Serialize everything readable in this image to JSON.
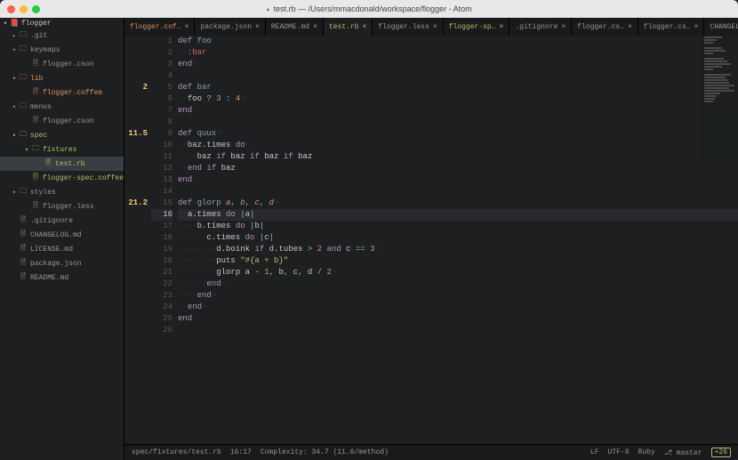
{
  "window": {
    "title": "test.rb — /Users/mmacdonald/workspace/flogger - Atom"
  },
  "sidebar": {
    "root": "flogger",
    "items": [
      {
        "pad": 12,
        "chev": "▸",
        "icon": "🗀",
        "label": ".git",
        "cls": ""
      },
      {
        "pad": 12,
        "chev": "▾",
        "icon": "🗀",
        "label": "keymaps",
        "cls": ""
      },
      {
        "pad": 26,
        "chev": "",
        "icon": "🗎",
        "label": "flogger.cson",
        "cls": ""
      },
      {
        "pad": 12,
        "chev": "▾",
        "icon": "🗀",
        "label": "lib",
        "cls": "modified"
      },
      {
        "pad": 26,
        "chev": "",
        "icon": "🗎",
        "label": "flogger.coffee",
        "cls": "modified"
      },
      {
        "pad": 12,
        "chev": "▾",
        "icon": "🗀",
        "label": "menus",
        "cls": ""
      },
      {
        "pad": 26,
        "chev": "",
        "icon": "🗎",
        "label": "flogger.cson",
        "cls": ""
      },
      {
        "pad": 12,
        "chev": "▾",
        "icon": "🗀",
        "label": "spec",
        "cls": "new"
      },
      {
        "pad": 26,
        "chev": "▾",
        "icon": "🗀",
        "label": "fixtures",
        "cls": "new"
      },
      {
        "pad": 40,
        "chev": "",
        "icon": "🗎",
        "label": "test.rb",
        "cls": "new active"
      },
      {
        "pad": 26,
        "chev": "",
        "icon": "🗎",
        "label": "flogger-spec.coffee",
        "cls": "new"
      },
      {
        "pad": 12,
        "chev": "▾",
        "icon": "🗀",
        "label": "styles",
        "cls": ""
      },
      {
        "pad": 26,
        "chev": "",
        "icon": "🗎",
        "label": "flogger.less",
        "cls": ""
      },
      {
        "pad": 12,
        "chev": "",
        "icon": "🗎",
        "label": ".gitignore",
        "cls": ""
      },
      {
        "pad": 12,
        "chev": "",
        "icon": "🗎",
        "label": "CHANGELOG.md",
        "cls": ""
      },
      {
        "pad": 12,
        "chev": "",
        "icon": "🗎",
        "label": "LICENSE.md",
        "cls": ""
      },
      {
        "pad": 12,
        "chev": "",
        "icon": "🗎",
        "label": "package.json",
        "cls": ""
      },
      {
        "pad": 12,
        "chev": "",
        "icon": "🗎",
        "label": "README.md",
        "cls": ""
      }
    ]
  },
  "tabs": [
    {
      "label": "flogger.cof…",
      "cls": "modified"
    },
    {
      "label": "package.json",
      "cls": ""
    },
    {
      "label": "README.md",
      "cls": ""
    },
    {
      "label": "test.rb",
      "cls": "new active"
    },
    {
      "label": "flogger.less",
      "cls": ""
    },
    {
      "label": "flogger-sp…",
      "cls": "new"
    },
    {
      "label": ".gitignore",
      "cls": ""
    },
    {
      "label": "flogger.cs…",
      "cls": ""
    },
    {
      "label": "flogger.cs…",
      "cls": ""
    },
    {
      "label": "CHANGEL…",
      "cls": ""
    }
  ],
  "complexity": {
    "5": "2",
    "9": "11.5",
    "15": "21.2"
  },
  "code_lines": [
    [
      [
        "kw",
        "def "
      ],
      [
        "def",
        "foo"
      ]
    ],
    [
      [
        "ws",
        "··"
      ],
      [
        "sym",
        ":bar"
      ]
    ],
    [
      [
        "kw",
        "end"
      ],
      [
        "ws",
        "¬"
      ]
    ],
    [],
    [
      [
        "kw",
        "def "
      ],
      [
        "def",
        "bar"
      ]
    ],
    [
      [
        "ws",
        "··"
      ],
      [
        "",
        "foo "
      ],
      [
        "op",
        "?"
      ],
      [
        "",
        " "
      ],
      [
        "num",
        "3"
      ],
      [
        "",
        " "
      ],
      [
        "op",
        ":"
      ],
      [
        "",
        " "
      ],
      [
        "num",
        "4"
      ],
      [
        "ws",
        "¬"
      ]
    ],
    [
      [
        "kw",
        "end"
      ]
    ],
    [],
    [
      [
        "kw",
        "def "
      ],
      [
        "def",
        "quux"
      ],
      [
        "ws",
        "¬"
      ]
    ],
    [
      [
        "ws",
        "··"
      ],
      [
        "",
        "baz.times "
      ],
      [
        "kw",
        "do"
      ],
      [
        "ws",
        "¬"
      ]
    ],
    [
      [
        "ws",
        "····"
      ],
      [
        "",
        "baz "
      ],
      [
        "kw",
        "if"
      ],
      [
        "",
        " baz "
      ],
      [
        "kw",
        "if"
      ],
      [
        "",
        " baz "
      ],
      [
        "kw",
        "if"
      ],
      [
        "",
        " baz"
      ]
    ],
    [
      [
        "ws",
        "··"
      ],
      [
        "kw",
        "end "
      ],
      [
        "kw",
        "if"
      ],
      [
        "",
        " baz"
      ]
    ],
    [
      [
        "kw",
        "end"
      ]
    ],
    [],
    [
      [
        "kw",
        "def "
      ],
      [
        "def",
        "glorp "
      ],
      [
        "var",
        "a"
      ],
      [
        "op",
        ", "
      ],
      [
        "var",
        "b"
      ],
      [
        "op",
        ", "
      ],
      [
        "var",
        "c"
      ],
      [
        "op",
        ", "
      ],
      [
        "var",
        "d"
      ],
      [
        "ws",
        "¬"
      ]
    ],
    [
      [
        "ws",
        "··"
      ],
      [
        "",
        "a.times "
      ],
      [
        "kw",
        "do"
      ],
      [
        "",
        " "
      ],
      [
        "op",
        "|"
      ],
      [
        "",
        "a"
      ],
      [
        "op",
        "|"
      ]
    ],
    [
      [
        "ws",
        "····"
      ],
      [
        "",
        "b.times "
      ],
      [
        "kw",
        "do"
      ],
      [
        "",
        " "
      ],
      [
        "op",
        "|"
      ],
      [
        "",
        "b"
      ],
      [
        "op",
        "|"
      ]
    ],
    [
      [
        "ws",
        "······"
      ],
      [
        "",
        "c.times "
      ],
      [
        "kw",
        "do"
      ],
      [
        "",
        " "
      ],
      [
        "op",
        "|"
      ],
      [
        "",
        "c"
      ],
      [
        "op",
        "|"
      ]
    ],
    [
      [
        "ws",
        "········"
      ],
      [
        "",
        "d.boink "
      ],
      [
        "kw",
        "if"
      ],
      [
        "",
        " d.tubes "
      ],
      [
        "op",
        ">"
      ],
      [
        "",
        " "
      ],
      [
        "num",
        "2"
      ],
      [
        "",
        " "
      ],
      [
        "kw",
        "and"
      ],
      [
        "",
        " c "
      ],
      [
        "op",
        "=="
      ],
      [
        "",
        " "
      ],
      [
        "num",
        "3"
      ],
      [
        "ws",
        "¬"
      ]
    ],
    [
      [
        "ws",
        "········"
      ],
      [
        "",
        "puts "
      ],
      [
        "str",
        "\"#{a + b}\""
      ]
    ],
    [
      [
        "ws",
        "········"
      ],
      [
        "",
        "glorp a "
      ],
      [
        "op",
        "-"
      ],
      [
        "",
        " "
      ],
      [
        "num",
        "1"
      ],
      [
        "op",
        ","
      ],
      [
        "",
        " b"
      ],
      [
        "op",
        ","
      ],
      [
        "",
        " c"
      ],
      [
        "op",
        ","
      ],
      [
        "",
        " d "
      ],
      [
        "op",
        "/"
      ],
      [
        "",
        " "
      ],
      [
        "num",
        "2"
      ],
      [
        "ws",
        "¬"
      ]
    ],
    [
      [
        "ws",
        "······"
      ],
      [
        "kw",
        "end"
      ],
      [
        "ws",
        "¬"
      ]
    ],
    [
      [
        "ws",
        "····"
      ],
      [
        "kw",
        "end"
      ],
      [
        "ws",
        "¬"
      ]
    ],
    [
      [
        "ws",
        "··"
      ],
      [
        "kw",
        "end"
      ],
      [
        "ws",
        "¬"
      ]
    ],
    [
      [
        "kw",
        "end"
      ]
    ],
    []
  ],
  "current_line": 16,
  "status": {
    "path": "spec/fixtures/test.rb",
    "cursor": "16:17",
    "complexity": "Complexity: 34.7 (11.6/method)",
    "eol": "LF",
    "encoding": "UTF-8",
    "grammar": "Ruby",
    "branch": "master",
    "git": "+26"
  }
}
